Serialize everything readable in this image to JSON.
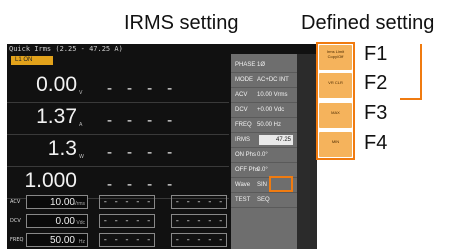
{
  "annotations": {
    "irms_setting": "IRMS setting",
    "defined_setting": "Defined setting",
    "f1": "F1",
    "f2": "F2",
    "f3": "F3",
    "f4": "F4"
  },
  "colors": {
    "accent": "#f07b10",
    "softkey": "#f5b35c",
    "badge": "#e3a31b"
  },
  "screen": {
    "title": "Quick Irms (2.25 - 47.25 A)",
    "badge": "L1  ON",
    "measurements": [
      {
        "value": "0.00",
        "unit": "V",
        "compare": "- - - -"
      },
      {
        "value": "1.37",
        "unit": "A",
        "compare": "- - - -"
      },
      {
        "value": "1.3",
        "unit": "W",
        "compare": "- - - -"
      },
      {
        "value": "1.000",
        "unit": "",
        "compare": "- - - -"
      }
    ],
    "settings": [
      {
        "label": "ACV",
        "value": "10.00",
        "unit": "Vrms",
        "box2": "- - - - -",
        "box3": "- - - - -"
      },
      {
        "label": "DCV",
        "value": "0.00",
        "unit": "Vdc",
        "box2": "- - - - -",
        "box3": "- - - - -"
      },
      {
        "label": "FREQ",
        "value": "50.00",
        "unit": "Hz",
        "box2": "- - - - -",
        "box3": "- - - - -"
      }
    ],
    "panel": [
      {
        "key": "PHASE",
        "value": "1Ø"
      },
      {
        "key": "MODE",
        "value": "AC+DC INT"
      },
      {
        "key": "ACV",
        "value": "10.00 Vrms"
      },
      {
        "key": "DCV",
        "value": "+0.00 Vdc"
      },
      {
        "key": "FREQ",
        "value": "50.00 Hz"
      },
      {
        "key": "IRMS",
        "value": "47.25"
      },
      {
        "key": "ON Phs",
        "value": "0.0°"
      },
      {
        "key": "OFF Phs",
        "value": "0.0°"
      },
      {
        "key": "Wave",
        "value": "SIN"
      },
      {
        "key": "TEST",
        "value": "SEQ"
      }
    ],
    "softkeys": [
      {
        "label": "Irms Limit Copy/Off"
      },
      {
        "label": "VR CLR"
      },
      {
        "label": "MAX"
      },
      {
        "label": "MIN"
      }
    ]
  }
}
